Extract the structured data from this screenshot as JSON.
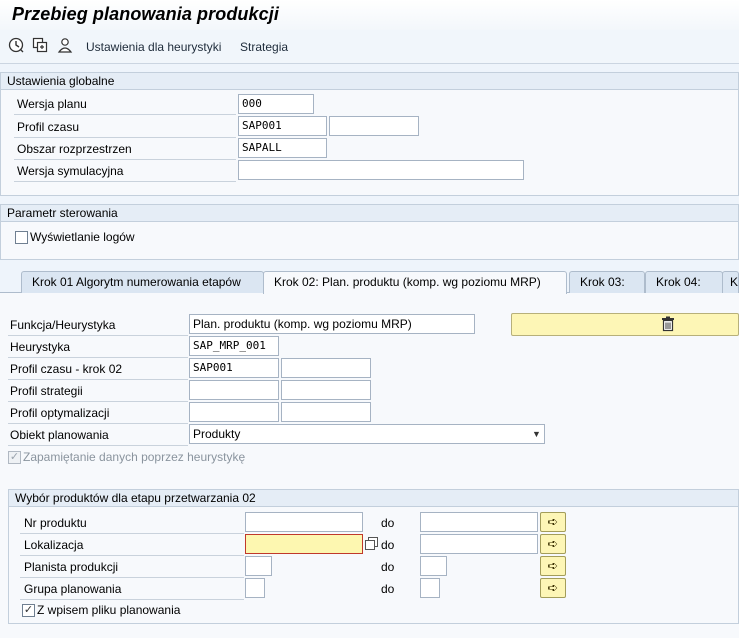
{
  "window": {
    "title": "Przebieg planowania produkcji"
  },
  "toolbar": {
    "execute_icon": "execute-clock-icon",
    "copy_icon": "copy-icon",
    "user_icon": "user-settings-icon",
    "heuristics_label": "Ustawienia dla heurystyki",
    "strategy_label": "Strategia"
  },
  "global": {
    "header": "Ustawienia globalne",
    "plan_version_label": "Wersja planu",
    "plan_version_value": "000",
    "time_profile_label": "Profil czasu",
    "time_profile_value": "SAP001",
    "time_profile_desc": "",
    "distribution_area_label": "Obszar rozprzestrzen",
    "distribution_area_value": "SAPALL",
    "simulation_version_label": "Wersja symulacyjna",
    "simulation_version_value": ""
  },
  "control": {
    "header": "Parametr sterowania",
    "show_logs_label": "Wyświetlanie logów",
    "show_logs_checked": false
  },
  "tabs": [
    {
      "label": "Krok 01 Algorytm numerowania etapów",
      "active": false
    },
    {
      "label": "Krok 02: Plan. produktu (komp. wg poziomu MRP)",
      "active": true
    },
    {
      "label": "Krok 03:",
      "active": false
    },
    {
      "label": "Krok 04:",
      "active": false
    },
    {
      "label": "Kr",
      "active": false
    }
  ],
  "step": {
    "function_label": "Funkcja/Heurystyka",
    "function_value": "Plan. produktu (komp. wg poziomu MRP)",
    "delete_icon": "trash-icon",
    "heuristic_label": "Heurystyka",
    "heuristic_value": "SAP_MRP_001",
    "time_profile_label": "Profil czasu - krok 02",
    "time_profile_value": "SAP001",
    "time_profile_desc": "",
    "strategy_profile_label": "Profil strategii",
    "strategy_profile_value": "",
    "optimization_profile_label": "Profil optymalizacji",
    "optimization_profile_value": "",
    "planning_object_label": "Obiekt planowania",
    "planning_object_value": "Produkty",
    "remember_label": "Zapamiętanie danych poprzez heurystykę",
    "remember_checked": true
  },
  "selection": {
    "header": "Wybór produktów dla etapu przetwarzania 02",
    "to_label": "do",
    "rows": [
      {
        "label": "Nr produktu",
        "from": "",
        "to": ""
      },
      {
        "label": "Lokalizacja",
        "from": "",
        "to": ""
      },
      {
        "label": "Planista produkcji",
        "from": "",
        "to": ""
      },
      {
        "label": "Grupa planowania",
        "from": "",
        "to": ""
      }
    ],
    "with_plan_file_label": "Z wpisem pliku planowania",
    "with_plan_file_checked": true
  }
}
